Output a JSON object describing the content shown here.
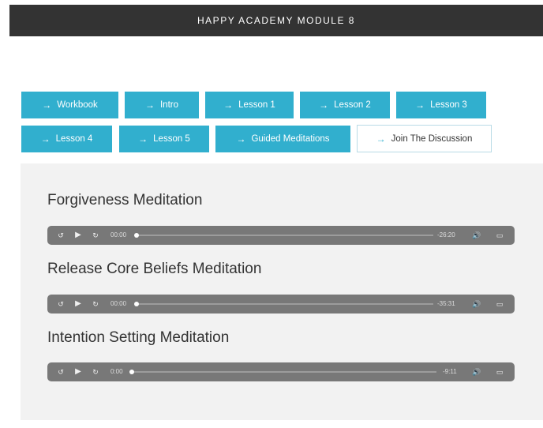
{
  "header": {
    "title": "HAPPY ACADEMY MODULE 8"
  },
  "nav": {
    "arrow": "→",
    "buttons": [
      {
        "label": "Workbook"
      },
      {
        "label": "Intro"
      },
      {
        "label": "Lesson 1"
      },
      {
        "label": "Lesson 2"
      },
      {
        "label": "Lesson 3"
      },
      {
        "label": "Lesson 4"
      },
      {
        "label": "Lesson 5"
      },
      {
        "label": "Guided Meditations"
      },
      {
        "label": "Join The Discussion"
      }
    ]
  },
  "tracks": [
    {
      "title": "Forgiveness Meditation",
      "current_time": "00:00",
      "remaining": "-26:20",
      "progress": 0
    },
    {
      "title": "Release Core Beliefs Meditation",
      "current_time": "00:00",
      "remaining": "-35:31",
      "progress": 0
    },
    {
      "title": "Intention Setting Meditation",
      "current_time": "0:00",
      "remaining": "-9:11",
      "progress": 0
    }
  ],
  "player_icons": {
    "rewind": "rewind-15-icon",
    "play": "play-icon",
    "forward": "forward-15-icon",
    "volume": "volume-icon",
    "airplay": "airplay-icon"
  },
  "colors": {
    "header_bg": "#333333",
    "nav_button_bg": "#31afce",
    "panel_bg": "#f2f2f2",
    "player_bg": "#787878"
  }
}
